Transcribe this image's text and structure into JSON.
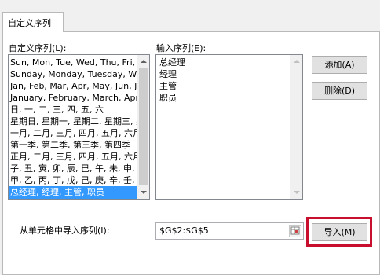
{
  "tab": {
    "label": "自定义序列"
  },
  "custom_lists": {
    "label": "自定义序列(L):",
    "items": [
      {
        "text": "Sun, Mon, Tue, Wed, Thu, Fri, S"
      },
      {
        "text": "Sunday, Monday, Tuesday, Wed"
      },
      {
        "text": "Jan, Feb, Mar, Apr, May, Jun, Ju"
      },
      {
        "text": "January, February, March, April"
      },
      {
        "text": "日, 一, 二, 三, 四, 五, 六"
      },
      {
        "text": "星期日, 星期一, 星期二, 星期三, 星"
      },
      {
        "text": "一月, 二月, 三月, 四月, 五月, 六月,"
      },
      {
        "text": "第一季, 第二季, 第三季, 第四季"
      },
      {
        "text": "正月, 二月, 三月, 四月, 五月, 六月,"
      },
      {
        "text": "子, 丑, 寅, 卯, 辰, 巳, 午, 未, 申, 酉"
      },
      {
        "text": "甲, 乙, 丙, 丁, 戊, 己, 庚, 辛, 壬, 癸"
      },
      {
        "text": "总经理, 经理, 主管, 职员"
      }
    ],
    "selected_index": 11
  },
  "list_entries": {
    "label": "输入序列(E):",
    "items": [
      "总经理",
      "经理",
      "主管",
      "职员"
    ]
  },
  "buttons": {
    "add": "添加(A)",
    "delete": "删除(D)",
    "import": "导入(M)"
  },
  "import_from_cells": {
    "label": "从单元格中导入序列(I):",
    "value": "$G$2:$G$5"
  },
  "colors": {
    "selection": "#3399ff",
    "highlight_border": "#c8102e"
  }
}
